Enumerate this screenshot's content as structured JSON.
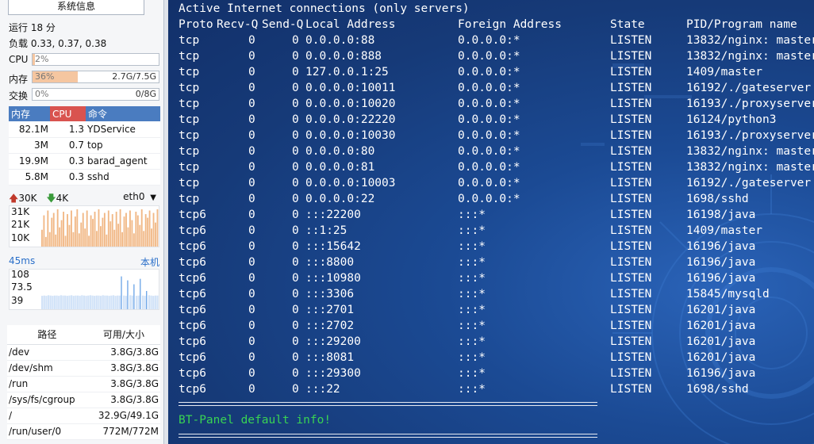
{
  "sidebar": {
    "title": "系统信息",
    "uptime": "运行 18 分",
    "load": "负载 0.33, 0.37, 0.38",
    "cpu": {
      "label": "CPU",
      "text": "2%",
      "percent": 2
    },
    "mem": {
      "label": "内存",
      "text": "36%",
      "percent": 36,
      "detail": "2.7G/7.5G"
    },
    "swap": {
      "label": "交换",
      "text": "0%",
      "percent": 0,
      "detail": "0/8G"
    },
    "process_headers": [
      "内存",
      "CPU",
      "命令"
    ],
    "processes": [
      {
        "mem": "82.1M",
        "cpu": "1.3",
        "cmd": "YDService"
      },
      {
        "mem": "3M",
        "cpu": "0.7",
        "cmd": "top"
      },
      {
        "mem": "19.9M",
        "cpu": "0.3",
        "cmd": "barad_agent"
      },
      {
        "mem": "5.8M",
        "cpu": "0.3",
        "cmd": "sshd"
      }
    ],
    "net": {
      "up": "30K",
      "down": "4K",
      "iface": "eth0",
      "axis": [
        "31K",
        "21K",
        "10K"
      ],
      "samples": [
        14,
        26,
        8,
        30,
        12,
        24,
        28,
        10,
        31,
        16,
        22,
        29,
        9,
        27,
        18,
        30,
        12,
        25,
        31,
        11,
        20,
        28,
        15,
        30,
        9,
        26,
        23,
        29,
        13,
        31,
        17,
        24,
        28,
        10,
        30,
        21,
        27,
        14,
        29,
        19,
        31,
        12,
        25,
        28,
        16,
        30,
        22,
        11,
        29,
        26,
        18,
        31,
        13,
        27,
        24,
        30,
        15,
        28,
        20,
        31
      ],
      "up_color": "#e67e22",
      "down_color": "#3a9a3a"
    },
    "ping": {
      "latency": "45ms",
      "target": "本机",
      "axis": [
        "108",
        "73.5",
        "39"
      ],
      "samples": [
        44,
        45,
        44,
        46,
        45,
        44,
        45,
        45,
        44,
        46,
        45,
        45,
        44,
        45,
        46,
        44,
        45,
        45,
        44,
        46,
        45,
        44,
        45,
        46,
        45,
        44,
        45,
        45,
        44,
        46,
        45,
        45,
        44,
        45,
        46,
        44,
        45,
        45,
        108,
        45,
        44,
        95,
        46,
        45,
        82,
        44,
        45,
        100,
        45,
        44,
        60,
        46,
        45,
        44,
        45,
        45
      ],
      "color": "#4a90e2"
    },
    "disk_headers": [
      "路径",
      "可用/大小"
    ],
    "disks": [
      {
        "path": "/dev",
        "size": "3.8G/3.8G"
      },
      {
        "path": "/dev/shm",
        "size": "3.8G/3.8G"
      },
      {
        "path": "/run",
        "size": "3.8G/3.8G"
      },
      {
        "path": "/sys/fs/cgroup",
        "size": "3.8G/3.8G"
      },
      {
        "path": "/",
        "size": "32.9G/49.1G"
      },
      {
        "path": "/run/user/0",
        "size": "772M/772M"
      }
    ]
  },
  "terminal": {
    "header": "Active Internet connections (only servers)",
    "columns": [
      "Proto",
      "Recv-Q",
      "Send-Q",
      "Local Address",
      "Foreign Address",
      "State",
      "PID/Program name"
    ],
    "rows": [
      [
        "tcp",
        "0",
        "0",
        "0.0.0.0:88",
        "0.0.0.0:*",
        "LISTEN",
        "13832/nginx: master"
      ],
      [
        "tcp",
        "0",
        "0",
        "0.0.0.0:888",
        "0.0.0.0:*",
        "LISTEN",
        "13832/nginx: master"
      ],
      [
        "tcp",
        "0",
        "0",
        "127.0.0.1:25",
        "0.0.0.0:*",
        "LISTEN",
        "1409/master"
      ],
      [
        "tcp",
        "0",
        "0",
        "0.0.0.0:10011",
        "0.0.0.0:*",
        "LISTEN",
        "16192/./gateserver"
      ],
      [
        "tcp",
        "0",
        "0",
        "0.0.0.0:10020",
        "0.0.0.0:*",
        "LISTEN",
        "16193/./proxyserver"
      ],
      [
        "tcp",
        "0",
        "0",
        "0.0.0.0:22220",
        "0.0.0.0:*",
        "LISTEN",
        "16124/python3"
      ],
      [
        "tcp",
        "0",
        "0",
        "0.0.0.0:10030",
        "0.0.0.0:*",
        "LISTEN",
        "16193/./proxyserver"
      ],
      [
        "tcp",
        "0",
        "0",
        "0.0.0.0:80",
        "0.0.0.0:*",
        "LISTEN",
        "13832/nginx: master"
      ],
      [
        "tcp",
        "0",
        "0",
        "0.0.0.0:81",
        "0.0.0.0:*",
        "LISTEN",
        "13832/nginx: master"
      ],
      [
        "tcp",
        "0",
        "0",
        "0.0.0.0:10003",
        "0.0.0.0:*",
        "LISTEN",
        "16192/./gateserver"
      ],
      [
        "tcp",
        "0",
        "0",
        "0.0.0.0:22",
        "0.0.0.0:*",
        "LISTEN",
        "1698/sshd"
      ],
      [
        "tcp6",
        "0",
        "0",
        ":::22200",
        ":::*",
        "LISTEN",
        "16198/java"
      ],
      [
        "tcp6",
        "0",
        "0",
        "::1:25",
        ":::*",
        "LISTEN",
        "1409/master"
      ],
      [
        "tcp6",
        "0",
        "0",
        ":::15642",
        ":::*",
        "LISTEN",
        "16196/java"
      ],
      [
        "tcp6",
        "0",
        "0",
        ":::8800",
        ":::*",
        "LISTEN",
        "16196/java"
      ],
      [
        "tcp6",
        "0",
        "0",
        ":::10980",
        ":::*",
        "LISTEN",
        "16196/java"
      ],
      [
        "tcp6",
        "0",
        "0",
        ":::3306",
        ":::*",
        "LISTEN",
        "15845/mysqld"
      ],
      [
        "tcp6",
        "0",
        "0",
        ":::2701",
        ":::*",
        "LISTEN",
        "16201/java"
      ],
      [
        "tcp6",
        "0",
        "0",
        ":::2702",
        ":::*",
        "LISTEN",
        "16201/java"
      ],
      [
        "tcp6",
        "0",
        "0",
        ":::29200",
        ":::*",
        "LISTEN",
        "16201/java"
      ],
      [
        "tcp6",
        "0",
        "0",
        ":::8081",
        ":::*",
        "LISTEN",
        "16201/java"
      ],
      [
        "tcp6",
        "0",
        "0",
        ":::29300",
        ":::*",
        "LISTEN",
        "16196/java"
      ],
      [
        "tcp6",
        "0",
        "0",
        ":::22",
        ":::*",
        "LISTEN",
        "1698/sshd"
      ]
    ],
    "banner": "BT-Panel default info!",
    "banner_color": "#39d353"
  }
}
